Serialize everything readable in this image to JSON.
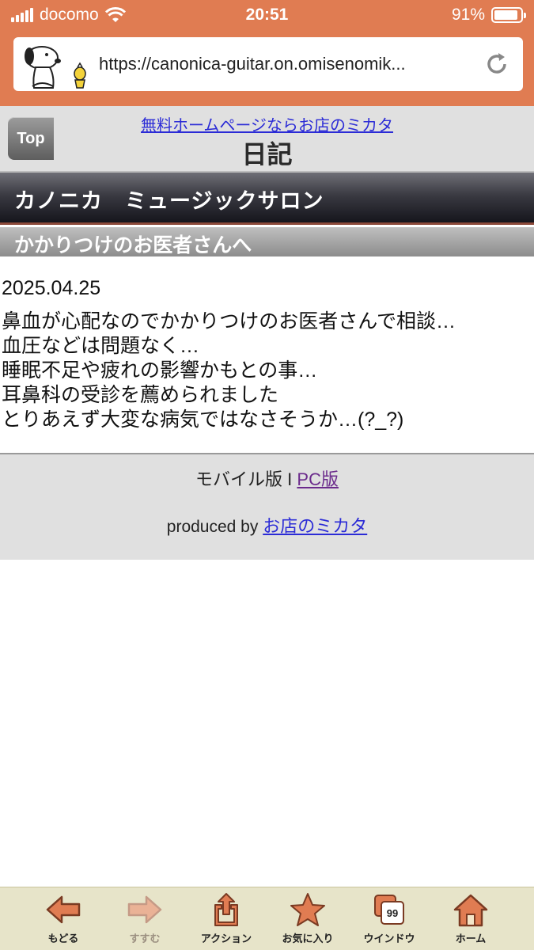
{
  "status_bar": {
    "carrier": "docomo",
    "time": "20:51",
    "battery_percent": "91%",
    "battery_level": 0.91
  },
  "browser": {
    "url": "https://canonica-guitar.on.omisenomik...",
    "reload_icon": "reload-icon"
  },
  "header": {
    "top_button": "Top",
    "promo_link": "無料ホームページならお店のミカタ",
    "title": "日記"
  },
  "site_name": "カノニカ　ミュージックサロン",
  "entry": {
    "title": "かかりつけのお医者さんへ",
    "date": "2025.04.25",
    "lines": [
      "鼻血が心配なのでかかりつけのお医者さんで相談…",
      "血圧などは問題なく…",
      "睡眠不足や疲れの影響かもとの事…",
      "耳鼻科の受診を薦められました",
      "とりあえず大変な病気ではなさそうか…(?_?)"
    ]
  },
  "footer": {
    "mobile_label": "モバイル版 I ",
    "pc_link": "PC版",
    "produced_by": "produced by ",
    "produced_link": "お店のミカタ"
  },
  "toolbar": {
    "items": [
      {
        "label": "もどる",
        "icon": "back-arrow-icon"
      },
      {
        "label": "すすむ",
        "icon": "forward-arrow-icon"
      },
      {
        "label": "アクション",
        "icon": "share-icon"
      },
      {
        "label": "お気に入り",
        "icon": "star-icon"
      },
      {
        "label": "ウインドウ",
        "icon": "windows-icon",
        "badge": "99"
      },
      {
        "label": "ホーム",
        "icon": "home-icon"
      }
    ]
  },
  "colors": {
    "chrome": "#e07c52",
    "toolbar_bg": "#e7e4c9",
    "icon_fill": "#e07c52"
  }
}
